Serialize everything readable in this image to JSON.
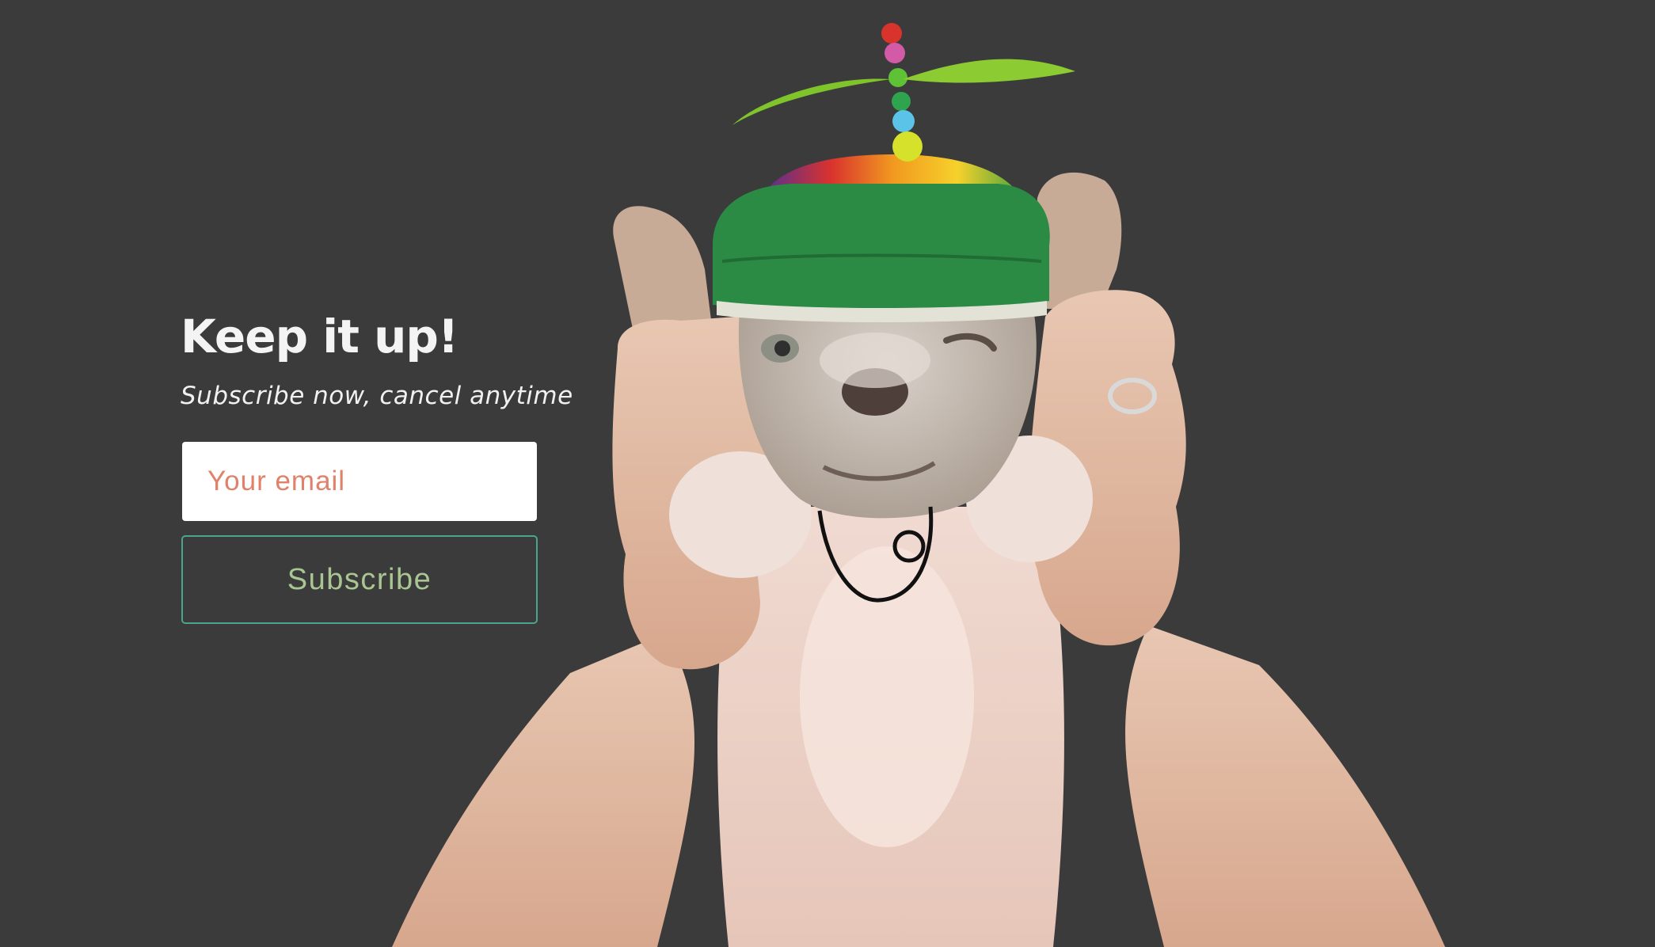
{
  "subscribe": {
    "title": "Keep it up!",
    "subtitle": "Subscribe now, cancel anytime",
    "email_placeholder": "Your email",
    "button_label": "Subscribe"
  },
  "colors": {
    "background": "#3b3b3b",
    "button_border": "#4aa58e",
    "button_text": "#a9c592",
    "placeholder_text": "#e0826a"
  },
  "hero_image": {
    "subject": "french bulldog wearing a propeller cap, held up by two hands"
  }
}
